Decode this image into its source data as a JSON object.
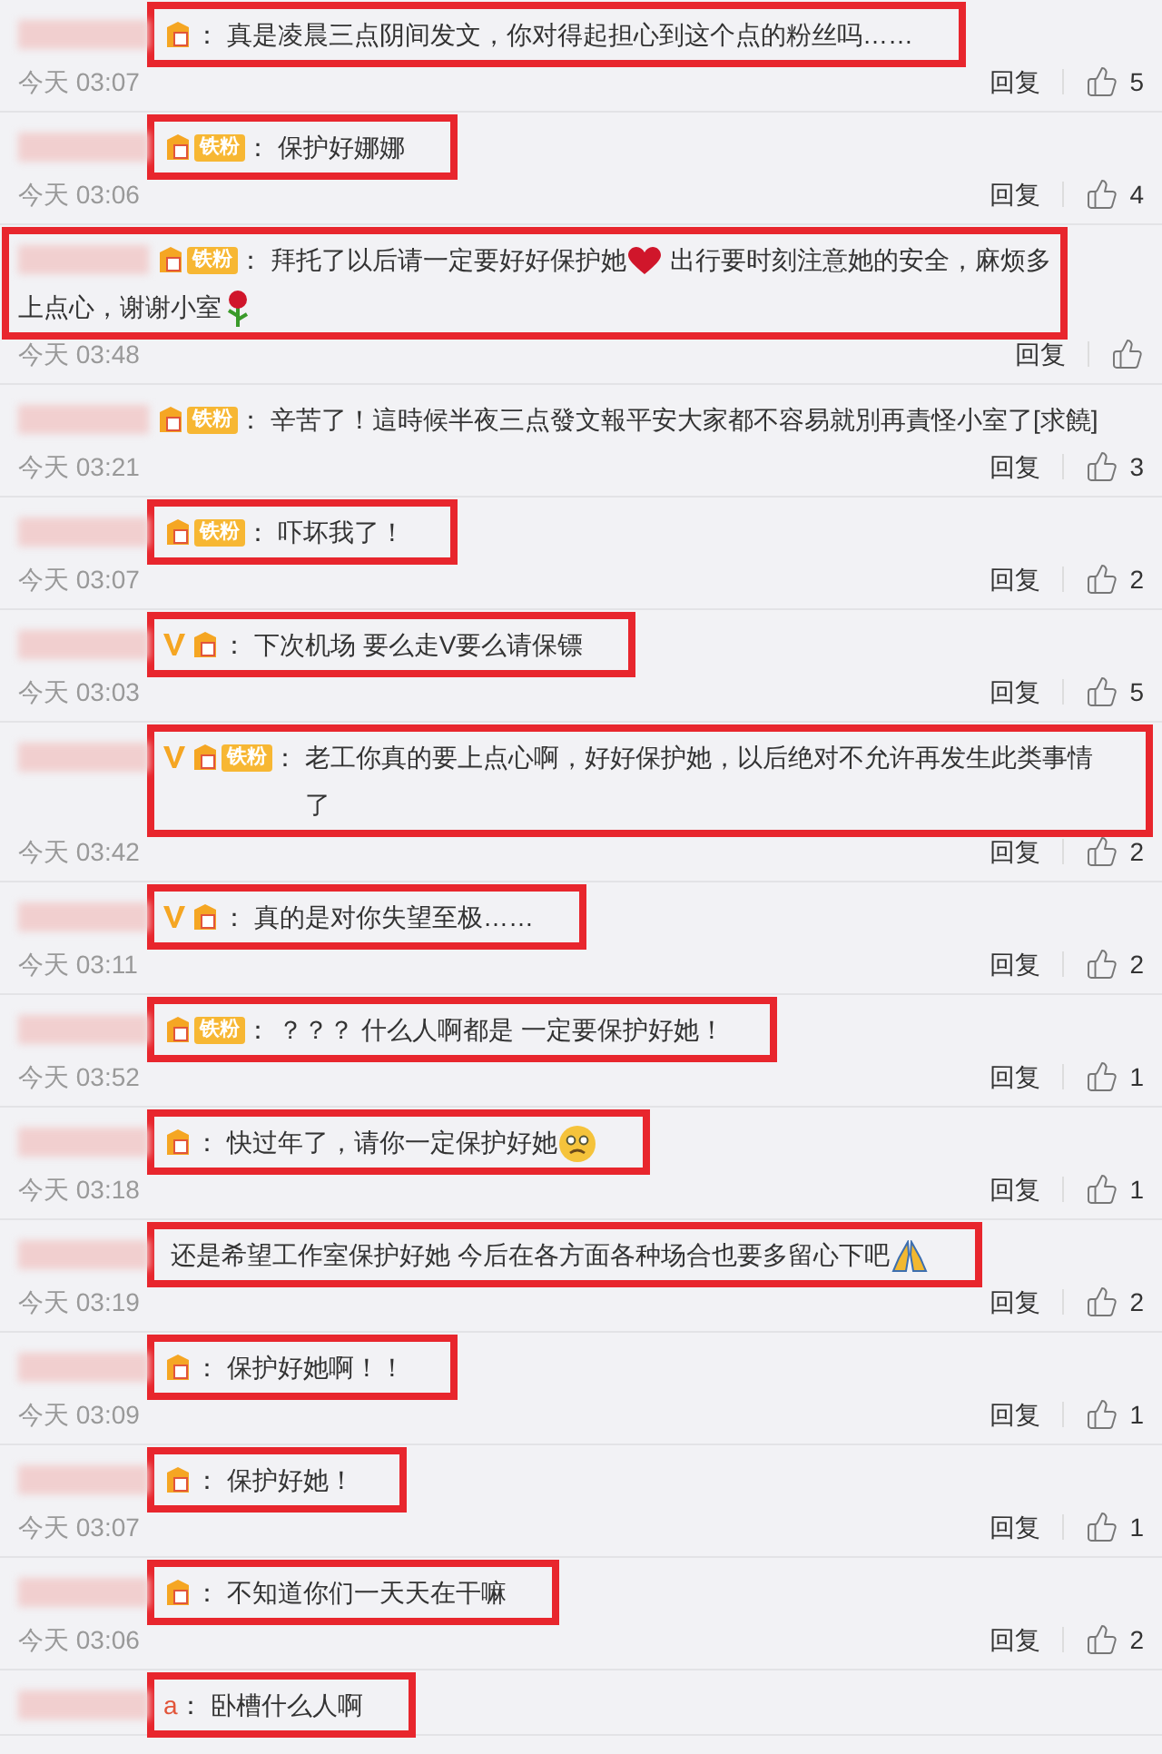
{
  "comments": [
    {
      "vip": false,
      "fan": true,
      "colon": "：",
      "highlighted": true,
      "parts": [
        {
          "kind": "text",
          "text": "真是凌晨三点阴间发文，你对得起担心到这个点的粉丝吗……"
        }
      ],
      "time": "今天 03:07",
      "reply": "回复",
      "likes": "5"
    },
    {
      "vip": false,
      "fan": true,
      "fan_label": "铁粉",
      "colon": "：",
      "highlighted": true,
      "parts": [
        {
          "kind": "text",
          "text": "保护好娜娜"
        }
      ],
      "time": "今天 03:06",
      "reply": "回复",
      "likes": "4"
    },
    {
      "vip": false,
      "fan": true,
      "fan_label": "铁粉",
      "colon": "：",
      "highlighted": true,
      "parts": [
        {
          "kind": "text",
          "text": "拜托了以后请一定要好好保护她"
        },
        {
          "kind": "heart"
        },
        {
          "kind": "text",
          "text": " 出行要时刻注意她的安全，麻烦多"
        }
      ],
      "continuation": [
        {
          "kind": "text",
          "text": "上点心，谢谢小室"
        },
        {
          "kind": "rose"
        }
      ],
      "time": "今天 03:48",
      "reply": "回复"
    },
    {
      "vip": false,
      "fan": true,
      "fan_label": "铁粉",
      "colon": "：",
      "highlighted": false,
      "parts": [
        {
          "kind": "text",
          "text": "辛苦了！這時候半夜三点發文報平安大家都不容易就別再責怪小室了[求饒]"
        }
      ],
      "time": "今天 03:21",
      "reply": "回复",
      "likes": "3"
    },
    {
      "vip": false,
      "fan": true,
      "fan_label": "铁粉",
      "colon": "：",
      "highlighted": true,
      "parts": [
        {
          "kind": "text",
          "text": "吓坏我了！"
        }
      ],
      "time": "今天 03:07",
      "reply": "回复",
      "likes": "2"
    },
    {
      "vip": true,
      "fan": true,
      "colon": "：",
      "highlighted": true,
      "parts": [
        {
          "kind": "text",
          "text": "下次机场 要么走V要么请保镖"
        }
      ],
      "time": "今天 03:03",
      "reply": "回复",
      "likes": "5"
    },
    {
      "vip": true,
      "fan": true,
      "fan_label": "铁粉",
      "colon": "：",
      "highlighted": true,
      "parts": [
        {
          "kind": "text",
          "text": "老工你真的要上点心啊，好好保护她，以后绝对不允许再发生此类事情了"
        }
      ],
      "time": "今天 03:42",
      "reply": "回复",
      "likes": "2"
    },
    {
      "vip": true,
      "fan": true,
      "colon": "：",
      "highlighted": true,
      "parts": [
        {
          "kind": "text",
          "text": "真的是对你失望至极……"
        }
      ],
      "time": "今天 03:11",
      "reply": "回复",
      "likes": "2"
    },
    {
      "vip": false,
      "fan": true,
      "fan_label": "铁粉",
      "colon": "：",
      "highlighted": true,
      "parts": [
        {
          "kind": "text",
          "text": "？？？ 什么人啊都是 一定要保护好她！"
        }
      ],
      "time": "今天 03:52",
      "reply": "回复",
      "likes": "1"
    },
    {
      "vip": false,
      "fan": true,
      "colon": "：",
      "highlighted": true,
      "parts": [
        {
          "kind": "text",
          "text": "快过年了，请你一定保护好她"
        },
        {
          "kind": "sad-face"
        }
      ],
      "time": "今天 03:18",
      "reply": "回复",
      "likes": "1"
    },
    {
      "vip": false,
      "fan": false,
      "highlighted": true,
      "parts": [
        {
          "kind": "text",
          "text": "还是希望工作室保护好她 今后在各方面各种场合也要多留心下吧"
        },
        {
          "kind": "pray"
        }
      ],
      "time": "今天 03:19",
      "reply": "回复",
      "likes": "2"
    },
    {
      "vip": false,
      "fan": true,
      "colon": "：",
      "highlighted": true,
      "parts": [
        {
          "kind": "text",
          "text": "保护好她啊！！"
        }
      ],
      "time": "今天 03:09",
      "reply": "回复",
      "likes": "1"
    },
    {
      "vip": false,
      "fan": true,
      "colon": "：",
      "highlighted": true,
      "parts": [
        {
          "kind": "text",
          "text": "保护好她！"
        }
      ],
      "time": "今天 03:07",
      "reply": "回复",
      "likes": "1"
    },
    {
      "vip": false,
      "fan": true,
      "colon": "：",
      "highlighted": true,
      "parts": [
        {
          "kind": "text",
          "text": "不知道你们一天天在干嘛"
        }
      ],
      "time": "今天 03:06",
      "reply": "回复",
      "likes": "2"
    },
    {
      "vip": false,
      "fan": false,
      "prefix": "a",
      "colon": "：",
      "highlighted": true,
      "parts": [
        {
          "kind": "text",
          "text": "卧槽什么人啊"
        }
      ]
    }
  ]
}
